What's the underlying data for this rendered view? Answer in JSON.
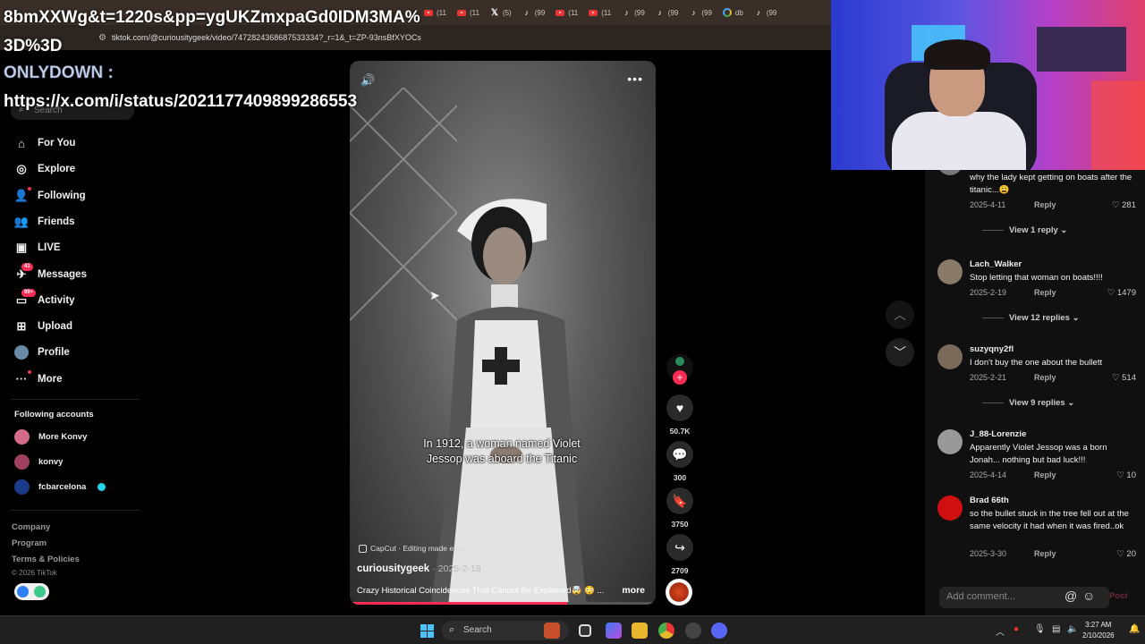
{
  "browser": {
    "tabs": [
      {
        "icon": "youtube-icon",
        "label": "(11"
      },
      {
        "icon": "youtube-icon",
        "label": "(11"
      },
      {
        "icon": "x-icon",
        "label": "(5)"
      },
      {
        "icon": "tiktok-icon",
        "label": "(99"
      },
      {
        "icon": "youtube-icon",
        "label": "(11"
      },
      {
        "icon": "youtube-icon",
        "label": "(11"
      },
      {
        "icon": "tiktok-icon",
        "label": "(99"
      },
      {
        "icon": "tiktok-icon",
        "label": "(99"
      },
      {
        "icon": "tiktok-icon",
        "label": "(99"
      },
      {
        "icon": "google-icon",
        "label": "db"
      },
      {
        "icon": "tiktok-icon",
        "label": "(99"
      }
    ],
    "url": "tiktok.com/@curiousitygeek/video/7472824368687533334?_r=1&_t=ZP-93nsBfXYOCs"
  },
  "overlay": {
    "url_text": "8bmXXWg&t=1220s&pp=ygUKZmxpaGd0IDM3MA%3D%3D",
    "label": "ONLYDOWN :",
    "status_url": "https://x.com/i/status/2021177409899286553"
  },
  "sidebar": {
    "search_placeholder": "Search",
    "nav": [
      {
        "label": "For You",
        "icon": "home-icon"
      },
      {
        "label": "Explore",
        "icon": "compass-icon"
      },
      {
        "label": "Following",
        "icon": "following-icon"
      },
      {
        "label": "Friends",
        "icon": "friends-icon"
      },
      {
        "label": "LIVE",
        "icon": "live-icon"
      },
      {
        "label": "Messages",
        "icon": "messages-icon",
        "badge": "41"
      },
      {
        "label": "Activity",
        "icon": "activity-icon",
        "badge": "99+"
      },
      {
        "label": "Upload",
        "icon": "upload-icon"
      },
      {
        "label": "Profile",
        "icon": "profile-avatar"
      },
      {
        "label": "More",
        "icon": "more-icon"
      }
    ],
    "following_title": "Following accounts",
    "accounts": [
      {
        "name": "More Konvy",
        "color": "#d46a8a"
      },
      {
        "name": "konvy",
        "color": "#a04060"
      },
      {
        "name": "fcbarcelona",
        "color": "#1a3a8a",
        "verified": true
      }
    ],
    "footer": [
      "Company",
      "Program",
      "Terms & Policies"
    ],
    "copyright": "© 2026 TikTok"
  },
  "video": {
    "caption": "In 1912, a woman named Violet Jessop was aboard the Titanic",
    "capcut": "CapCut · Editing made easy",
    "author": "curiousitygeek",
    "date": "· 2025-2-18",
    "description": "Crazy Historical Coincidences That Cannot Be Explained🤯 😳 ...",
    "more": "more",
    "progress": 0.71
  },
  "actions": {
    "likes": "50.7K",
    "comments": "300",
    "saves": "3750",
    "shares": "2709"
  },
  "comments": [
    {
      "user": "",
      "text": "why the lady kept getting on boats after the titanic...😩",
      "date": "2025-4-11",
      "likes": "281",
      "replies": "View 1 reply",
      "color": "#777"
    },
    {
      "user": "Lach_Walker",
      "text": "Stop letting that woman on boats!!!!",
      "date": "2025-2-19",
      "likes": "1479",
      "replies": "View 12 replies",
      "color": "#8a7a6a"
    },
    {
      "user": "suzyqny2fl",
      "text": "I don't buy the one about the bullett",
      "date": "2025-2-21",
      "likes": "514",
      "replies": "View 9 replies",
      "color": "#7a6a5a"
    },
    {
      "user": "J_88-Lorenzie",
      "text": "Apparently Violet Jessop was a born Jonah... nothing but bad luck!!!",
      "date": "2025-4-14",
      "likes": "10",
      "replies": "",
      "color": "#999"
    },
    {
      "user": "Brad 66th",
      "text": "so the bullet stuck in the tree fell out at the same velocity it had when it was fired..ok",
      "date": "2025-3-30",
      "likes": "20",
      "replies": "",
      "color": "#d01010"
    }
  ],
  "comment_input": {
    "placeholder": "Add comment...",
    "post": "Post"
  },
  "common": {
    "reply": "Reply"
  },
  "taskbar": {
    "search": "Search",
    "time": "3:27 AM",
    "date": "2/10/2026"
  }
}
